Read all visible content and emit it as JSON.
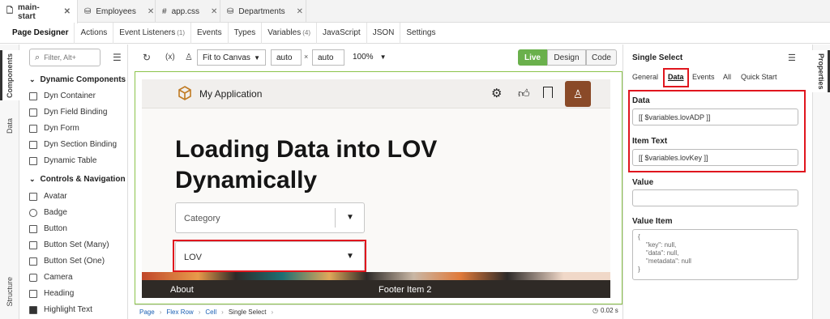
{
  "file_tabs": [
    {
      "label": "main-start",
      "icon": "file-icon"
    },
    {
      "label": "Employees",
      "icon": "database-icon"
    },
    {
      "label": "app.css",
      "icon": "hash-icon"
    },
    {
      "label": "Departments",
      "icon": "database-icon"
    }
  ],
  "page_tabs": [
    {
      "label": "Page Designer"
    },
    {
      "label": "Actions"
    },
    {
      "label": "Event Listeners",
      "count": "(1)"
    },
    {
      "label": "Events"
    },
    {
      "label": "Types"
    },
    {
      "label": "Variables",
      "count": "(4)"
    },
    {
      "label": "JavaScript"
    },
    {
      "label": "JSON"
    },
    {
      "label": "Settings"
    }
  ],
  "left_rail": {
    "components": "Components",
    "data": "Data",
    "structure": "Structure"
  },
  "search": {
    "placeholder": "Filter, Alt+"
  },
  "components": {
    "section1": "Dynamic Components",
    "items1": [
      "Dyn Container",
      "Dyn Field Binding",
      "Dyn Form",
      "Dyn Section Binding",
      "Dynamic Table"
    ],
    "section2": "Controls & Navigation",
    "items2": [
      "Avatar",
      "Badge",
      "Button",
      "Button Set (Many)",
      "Button Set (One)",
      "Camera",
      "Heading",
      "Highlight Text"
    ]
  },
  "toolbar": {
    "fit": "Fit to Canvas",
    "width": "auto",
    "height": "auto",
    "zoom": "100%",
    "modes": [
      "Live",
      "Design",
      "Code"
    ]
  },
  "app": {
    "title": "My Application",
    "heading_line1": "Loading Data into LOV",
    "heading_line2": "Dynamically",
    "select1": "Category",
    "select2": "LOV",
    "footer1": "About",
    "footer2": "Footer Item 2"
  },
  "breadcrumb": [
    "Page",
    "Flex Row",
    "Cell",
    "Single Select"
  ],
  "timing": "0.02 s",
  "properties": {
    "rail": "Properties",
    "title": "Single Select",
    "tabs": [
      "General",
      "Data",
      "Events",
      "All",
      "Quick Start"
    ],
    "data_label": "Data",
    "data_value": "[[ $variables.lovADP ]]",
    "item_text_label": "Item Text",
    "item_text_value": "[[ $variables.lovKey ]]",
    "value_label": "Value",
    "value_item_label": "Value Item",
    "value_item_lines": [
      "{",
      "\"key\": null,",
      "\"data\": null,",
      "\"metadata\": null",
      "}"
    ]
  },
  "colors": {
    "accent_green": "#6ab04c",
    "highlight_red": "#e0161e",
    "footer_dark": "#2f2a26"
  }
}
